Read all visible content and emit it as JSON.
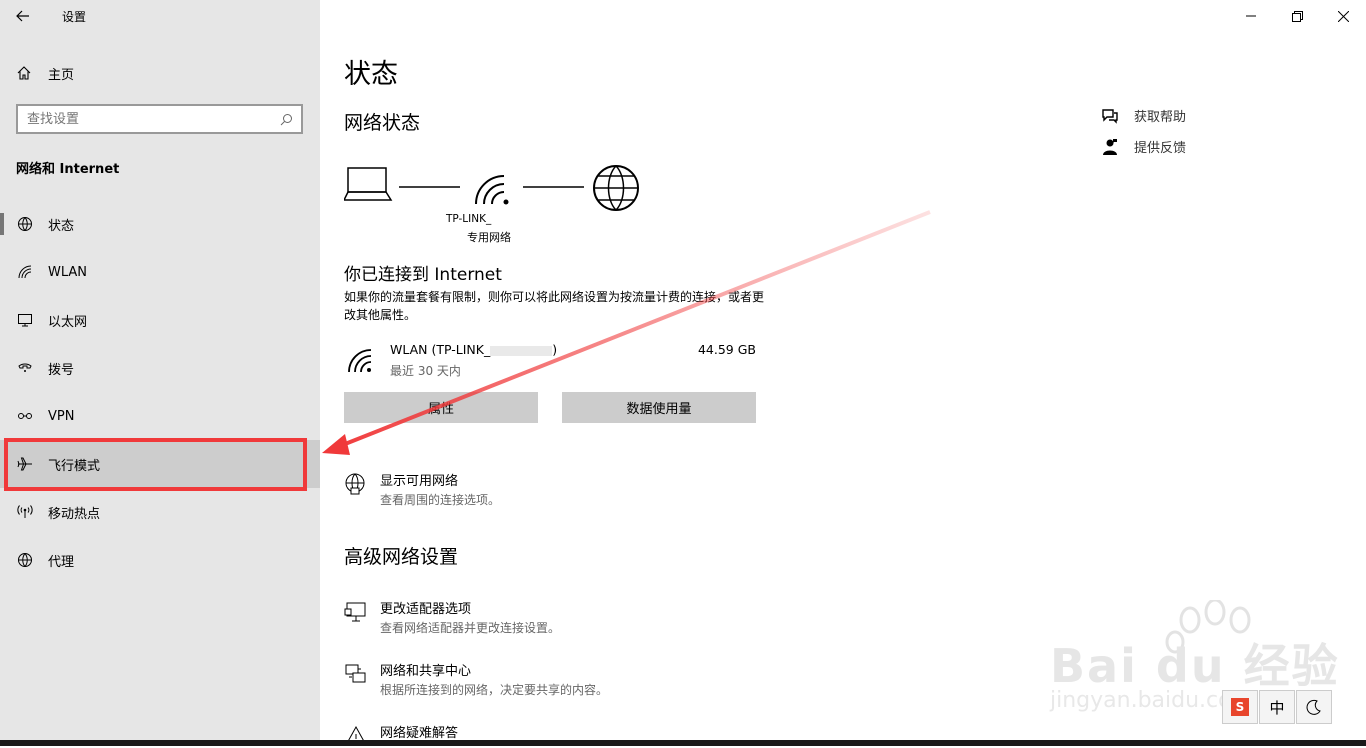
{
  "window": {
    "title": "设置"
  },
  "sidebar": {
    "home_label": "主页",
    "search_placeholder": "查找设置",
    "section_title": "网络和 Internet",
    "items": [
      {
        "label": "状态",
        "icon": "globe-grid-icon"
      },
      {
        "label": "WLAN",
        "icon": "wifi-icon"
      },
      {
        "label": "以太网",
        "icon": "ethernet-icon"
      },
      {
        "label": "拨号",
        "icon": "dialup-icon"
      },
      {
        "label": "VPN",
        "icon": "vpn-icon"
      },
      {
        "label": "飞行模式",
        "icon": "airplane-icon"
      },
      {
        "label": "移动热点",
        "icon": "hotspot-icon"
      },
      {
        "label": "代理",
        "icon": "globe-icon"
      }
    ]
  },
  "main": {
    "page_title": "状态",
    "network_status_title": "网络状态",
    "network_name": "TP-LINK_",
    "network_type": "专用网络",
    "connected_title": "你已连接到 Internet",
    "connected_desc": "如果你的流量套餐有限制，则你可以将此网络设置为按流量计费的连接，或者更改其他属性。",
    "connection": {
      "name": "WLAN (TP-LINK_",
      "name_suffix": ")",
      "period": "最近 30 天内",
      "usage": "44.59 GB"
    },
    "buttons": {
      "properties": "属性",
      "data_usage": "数据使用量"
    },
    "show_networks": {
      "title": "显示可用网络",
      "desc": "查看周围的连接选项。"
    },
    "advanced_title": "高级网络设置",
    "adapter_options": {
      "title": "更改适配器选项",
      "desc": "查看网络适配器并更改连接设置。"
    },
    "sharing_center": {
      "title": "网络和共享中心",
      "desc": "根据所连接到的网络，决定要共享的内容。"
    },
    "troubleshoot": {
      "title": "网络疑难解答"
    }
  },
  "help": {
    "get_help": "获取帮助",
    "feedback": "提供反馈"
  },
  "watermark": {
    "brand": "Bai du 经验",
    "url": "jingyan.baidu.com"
  },
  "ime": {
    "mode": "中"
  },
  "colors": {
    "sidebar_bg": "#e6e6e6",
    "highlight_border": "#f0393a",
    "button_bg": "#cccccc"
  }
}
